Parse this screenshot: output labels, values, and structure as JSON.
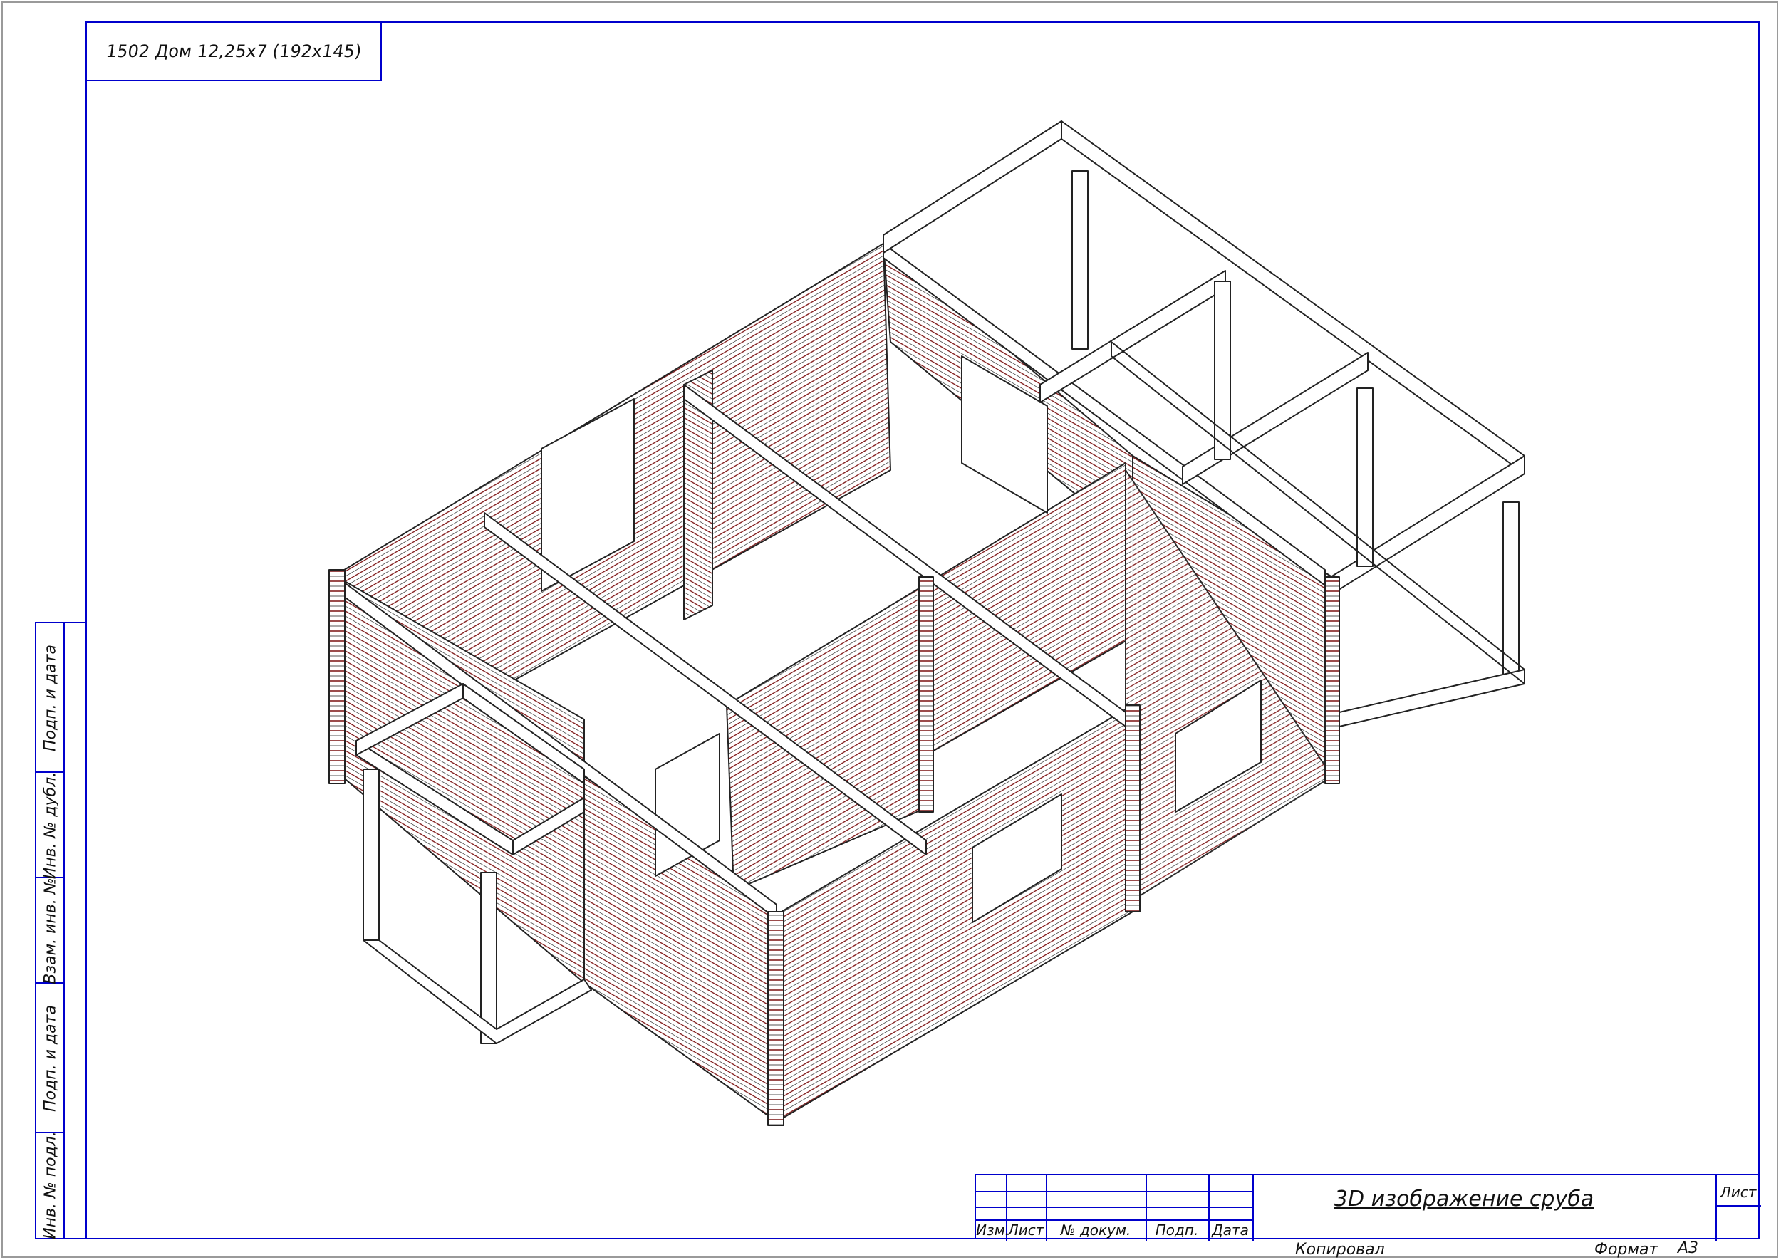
{
  "drawing_title": "1502 Дом 12,25х7 (192х145)",
  "sheet_title": "3D изображение сруба",
  "sheet_label": "Лист",
  "side_stamp": [
    "Подп. и дата",
    "Инв. № дубл.",
    "Взам. инв. №",
    "Подп. и дата",
    "Инв. № подл."
  ],
  "title_block": {
    "columns": [
      "Изм.",
      "Лист",
      "№ докум.",
      "Подп.",
      "Дата"
    ]
  },
  "footer": {
    "copied": "Копировал",
    "format_label": "Формат",
    "format_value": "А3"
  },
  "colors": {
    "frame": "#0000cc",
    "log_lines": "#7a1010",
    "outline": "#222222"
  }
}
